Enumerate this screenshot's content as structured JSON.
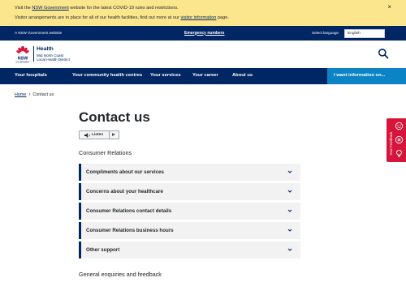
{
  "alert": {
    "line1_prefix": "Visit the ",
    "line1_link": "NSW Government",
    "line1_suffix": " website for the latest COVID-19 rules and restrictions.",
    "line2_prefix": "Visitor arrangements are in place for all of our health facilities, find out more at our ",
    "line2_link": "visitor information",
    "line2_suffix": " page.",
    "close": "×"
  },
  "masthead": {
    "site_label": "A NSW Government website",
    "emergency": "Emergency numbers",
    "lang_label": "Select language",
    "lang_value": "English"
  },
  "header": {
    "brand": "Health",
    "district_line1": "Mid North Coast",
    "district_line2": "Local Health District",
    "logo_text": "NSW",
    "logo_sub": "GOVERNMENT"
  },
  "nav": {
    "items": [
      "Your hospitals",
      "Your community health centres",
      "Your services",
      "Your career",
      "About us"
    ],
    "cta": "I want information on..."
  },
  "breadcrumb": {
    "home": "Home",
    "current": "Contact us"
  },
  "main": {
    "title": "Contact us",
    "listen": "Listen",
    "consumer_heading": "Consumer Relations",
    "accordions": [
      "Compliments about our services",
      "Concerns about your healthcare",
      "Consumer Relations contact details",
      "Consumer Relations business hours",
      "Other support"
    ],
    "general_heading": "General enquiries and feedback"
  },
  "feedback": {
    "label": "Your Feedback"
  },
  "colors": {
    "navy": "#002664",
    "alert_yellow": "#fce68d",
    "cta_blue": "#0b83c4",
    "feedback_red": "#d7153a"
  },
  "icons": [
    "close-icon",
    "nsw-waratah-logo",
    "search-icon",
    "chevron-right-icon",
    "speaker-icon",
    "play-icon",
    "chevron-down-icon",
    "smile-icon",
    "cancel-circle-icon",
    "lightbulb-icon"
  ]
}
